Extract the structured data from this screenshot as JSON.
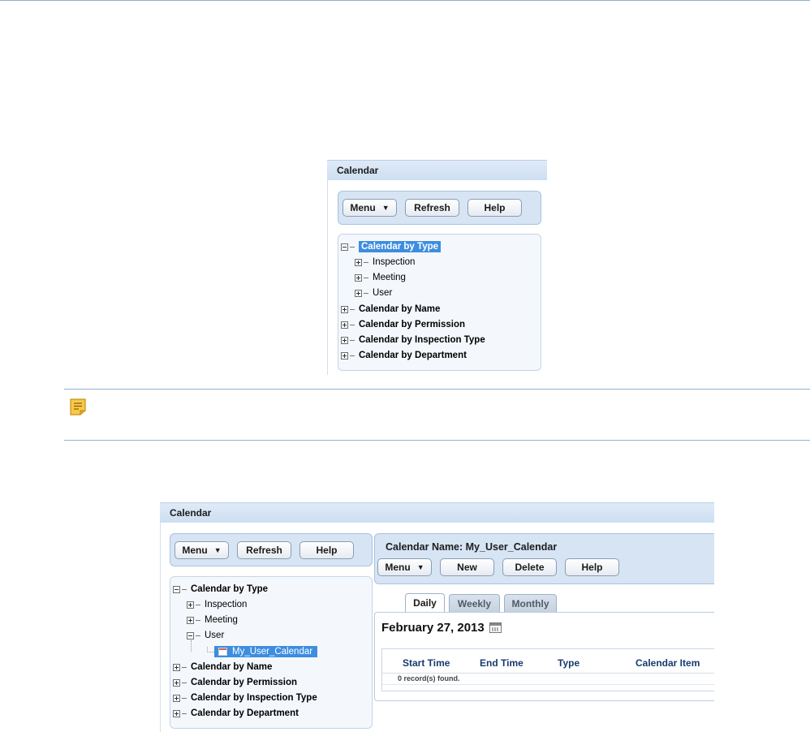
{
  "top_widget": {
    "panel_title": "Calendar",
    "toolbar": {
      "menu": "Menu",
      "refresh": "Refresh",
      "help": "Help"
    },
    "tree": {
      "root": "Calendar by Type",
      "children": [
        "Inspection",
        "Meeting",
        "User"
      ],
      "others": [
        "Calendar by Name",
        "Calendar by Permission",
        "Calendar by Inspection Type",
        "Calendar by Department"
      ]
    }
  },
  "note_icon": "note-icon",
  "bottom_widget": {
    "panel_title": "Calendar",
    "toolbar": {
      "menu": "Menu",
      "refresh": "Refresh",
      "help": "Help"
    },
    "tree": {
      "root": "Calendar by Type",
      "children": [
        "Inspection",
        "Meeting",
        "User"
      ],
      "user_child": "My_User_Calendar",
      "others": [
        "Calendar by Name",
        "Calendar by Permission",
        "Calendar by Inspection Type",
        "Calendar by Department"
      ]
    },
    "detail": {
      "calendar_name_label": "Calendar Name: My_User_Calendar",
      "menu": "Menu",
      "new": "New",
      "delete": "Delete",
      "help": "Help",
      "tabs": [
        "Daily",
        "Weekly",
        "Monthly"
      ],
      "date": "February 27, 2013",
      "columns": [
        "Start Time",
        "End Time",
        "Type",
        "Calendar Item"
      ],
      "records": "0 record(s) found."
    }
  },
  "colors": {
    "accent": "#3d8de0",
    "header": "#d6e4f4",
    "rule": "#8fb3cc"
  }
}
